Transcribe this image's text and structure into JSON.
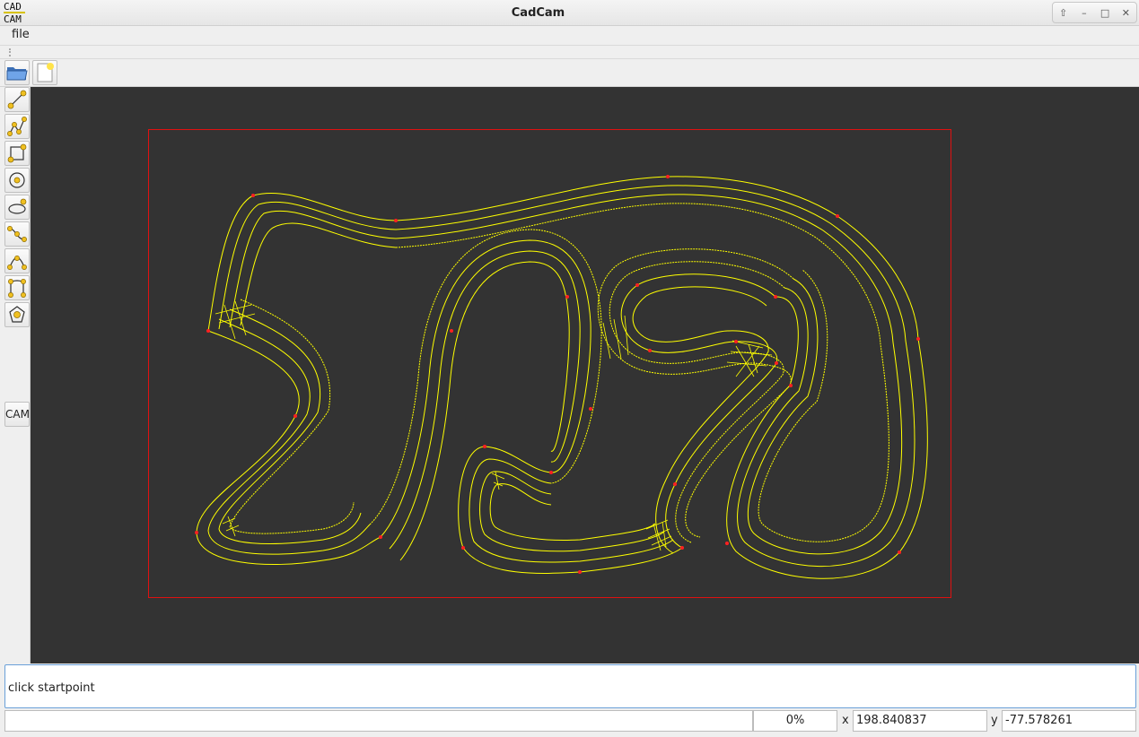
{
  "window": {
    "title": "CadCam",
    "logo_line1": "CAD",
    "logo_line2": "CAM"
  },
  "menu": {
    "file_label": "file"
  },
  "toolbar": {
    "open_icon": "folder-open-icon",
    "new_icon": "new-document-icon"
  },
  "side_tools": [
    {
      "icon": "line-tool-icon"
    },
    {
      "icon": "polyline-tool-icon"
    },
    {
      "icon": "rectangle-tool-icon"
    },
    {
      "icon": "circle-tool-icon"
    },
    {
      "icon": "ellipse-tool-icon"
    },
    {
      "icon": "spline-tool-icon"
    },
    {
      "icon": "arc-tool-icon"
    },
    {
      "icon": "curve-tool-icon"
    },
    {
      "icon": "polygon-tool-icon"
    }
  ],
  "cam_label": "CAM",
  "prompt": {
    "text": "click startpoint"
  },
  "status": {
    "progress_text": "0%",
    "progress_value": 0,
    "x_label": "x",
    "x_value": "198.840837",
    "y_label": "y",
    "y_value": "-77.578261"
  },
  "colors": {
    "canvas_bg": "#333333",
    "toolpath": "#ffff00",
    "boundary": "#e01010",
    "control_point": "#ff2020"
  }
}
